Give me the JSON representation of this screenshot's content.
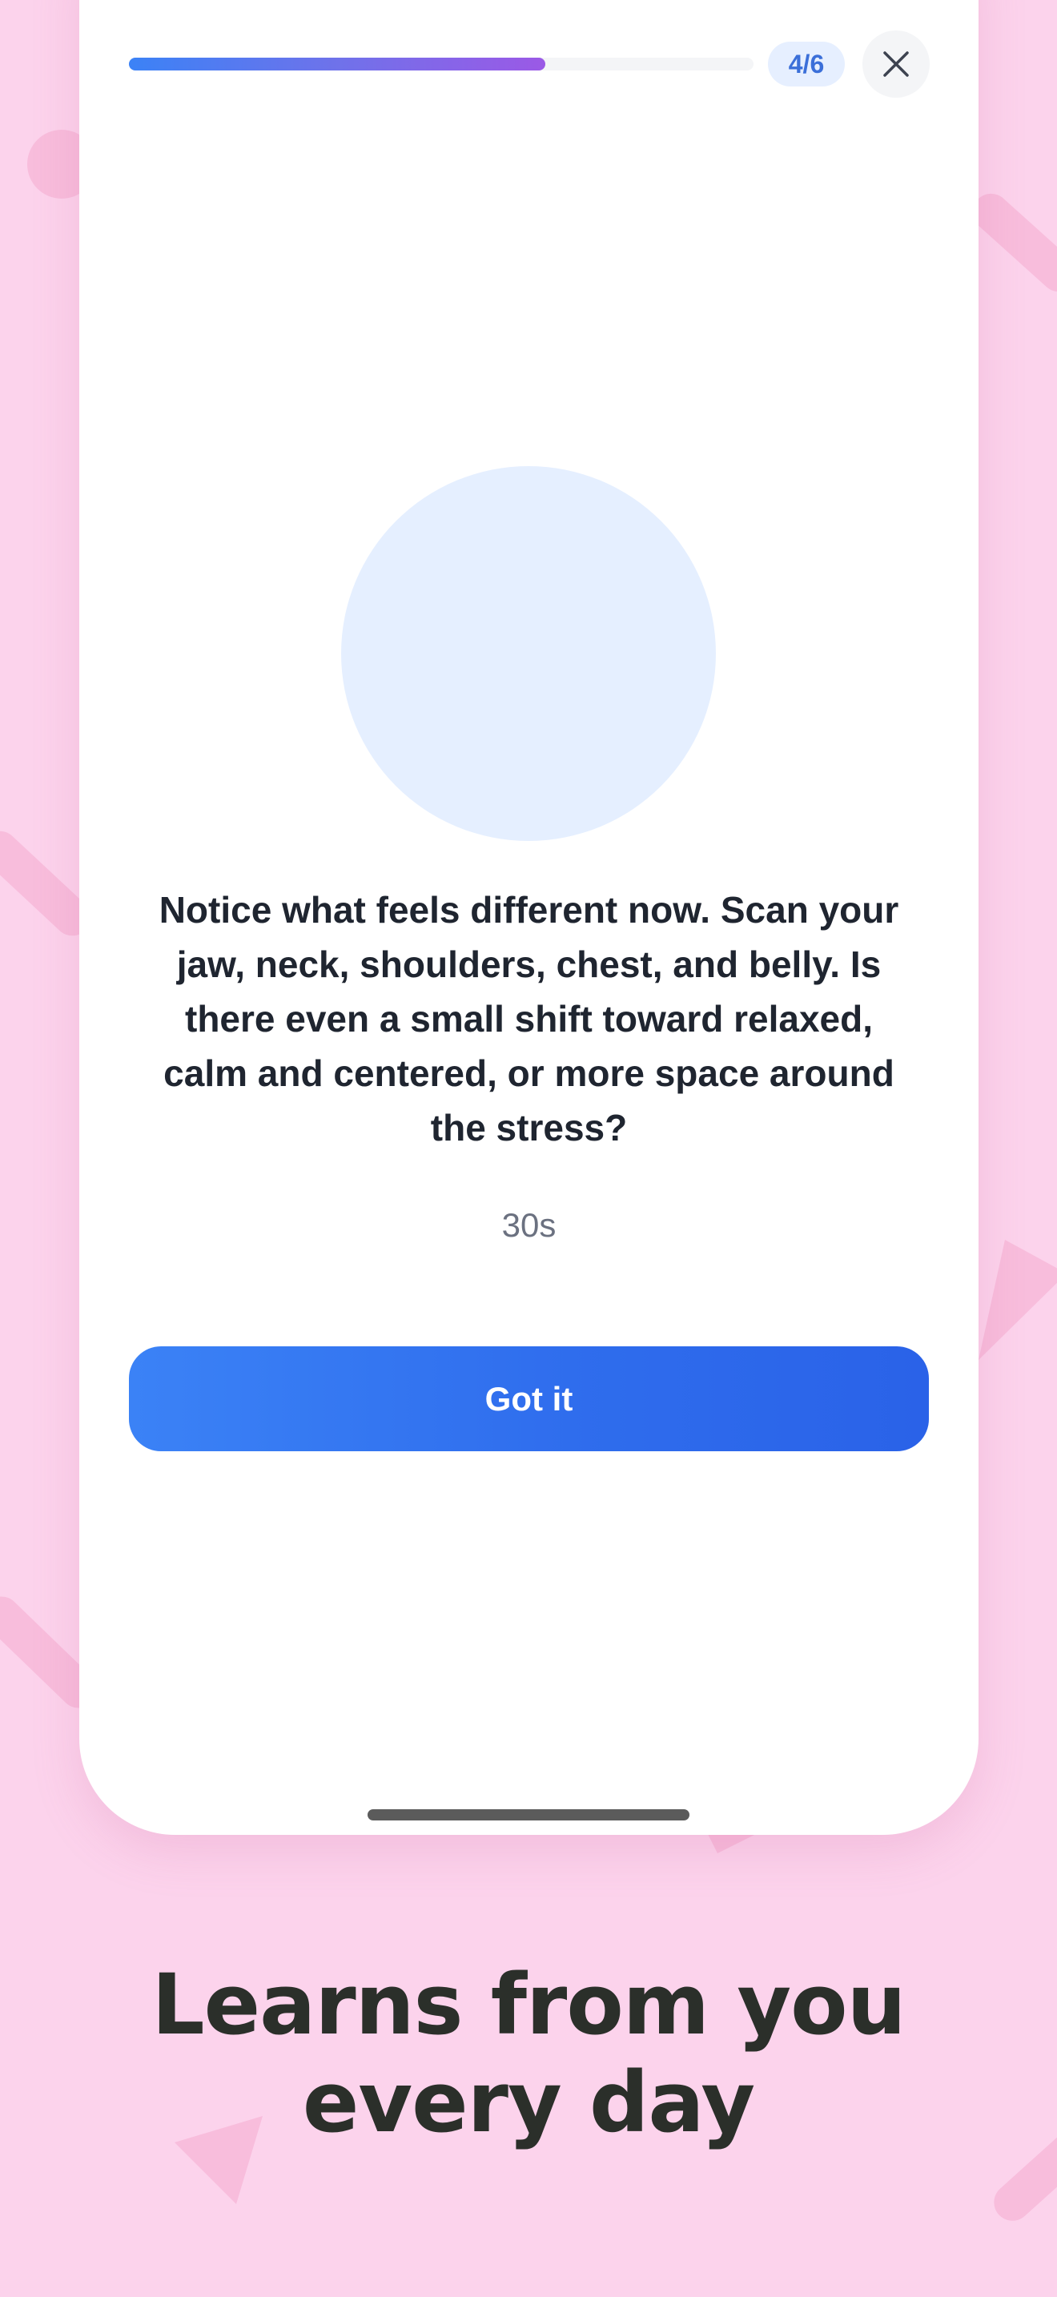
{
  "progress": {
    "step_label": "4/6",
    "fraction": 0.667
  },
  "close_button": {
    "icon": "close-icon"
  },
  "exercise": {
    "prompt": "Notice what feels different now. Scan your jaw, neck, shoulders, chest, and belly. Is there even a small shift toward relaxed, calm and centered, or more space around the stress?",
    "timer": "30s"
  },
  "actions": {
    "got_it_label": "Got it"
  },
  "marketing": {
    "headline": "Learns from you every day"
  },
  "colors": {
    "background": "#fcd3ec",
    "accent_blue": "#3b82f6",
    "accent_purple": "#9b59e6",
    "circle": "#e5efff",
    "headline_text": "#2b2f2a"
  }
}
